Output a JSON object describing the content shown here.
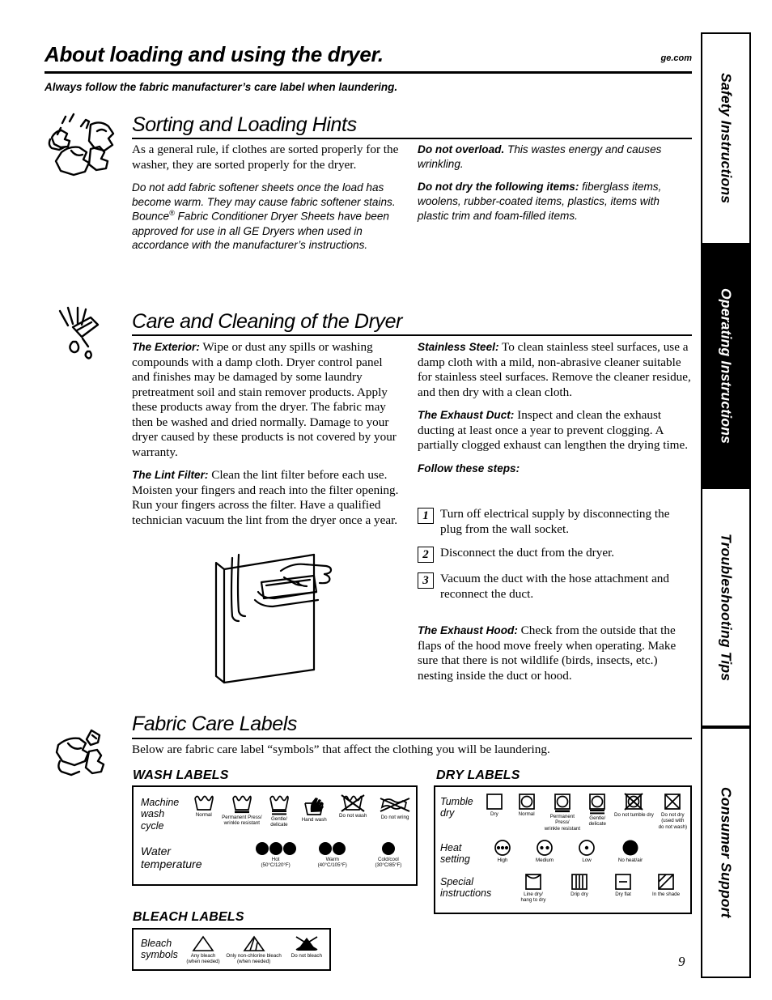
{
  "header": {
    "title": "About loading and using the dryer.",
    "url": "ge.com",
    "subhead": "Always follow the fabric manufacturer’s care label when laundering."
  },
  "sidebar": {
    "tabs": [
      {
        "label": "Safety Instructions",
        "active": false
      },
      {
        "label": "Operating Instructions",
        "active": true
      },
      {
        "label": "Troubleshooting Tips",
        "active": false
      },
      {
        "label": "Consumer Support",
        "active": false
      }
    ]
  },
  "sections": {
    "sorting": {
      "title": "Sorting and Loading Hints",
      "left": {
        "p1": "As a general rule, if clothes are sorted properly for the washer, they are sorted properly for the dryer.",
        "p2_a": "Do not add fabric softener sheets once the load has become warm. They may cause fabric softener stains. Bounce",
        "p2_sup": "®",
        "p2_b": " Fabric Conditioner Dryer Sheets have been approved for use in all GE Dryers when used in accordance with the manufacturer’s instructions."
      },
      "right": {
        "p1_lead": "Do not overload.",
        "p1_body": " This wastes energy and causes wrinkling.",
        "p2_lead": "Do not dry the following items:",
        "p2_body": " fiberglass items, woolens, rubber-coated items, plastics, items with plastic trim and foam-filled items."
      }
    },
    "care": {
      "title": "Care and Cleaning of the Dryer",
      "left": {
        "p1_lead": "The Exterior:",
        "p1_body": " Wipe or dust any spills or washing compounds with a damp cloth. Dryer control panel and finishes may be damaged by some laundry pretreatment soil and stain remover products. Apply these products away from the dryer. The fabric may then be washed and dried normally. Damage to your dryer caused by these products is not covered by your warranty.",
        "p2_lead": "The Lint Filter:",
        "p2_body": " Clean the lint filter before each use. Moisten your fingers and reach into the filter opening. Run your fingers across the filter. Have a qualified technician vacuum the lint from the dryer once a year."
      },
      "right": {
        "p1_lead": "Stainless Steel:",
        "p1_body": " To clean stainless steel surfaces, use a damp cloth with a mild, non-abrasive cleaner suitable for stainless steel surfaces. Remove the cleaner residue, and then dry with a clean cloth.",
        "p2_lead": "The Exhaust Duct:",
        "p2_body": " Inspect and clean the exhaust ducting at least once a year to prevent clogging. A partially clogged exhaust can lengthen the drying time.",
        "steps_label": "Follow these steps:",
        "steps": [
          {
            "num": "1",
            "text": "Turn off electrical supply by disconnecting the plug from the wall socket."
          },
          {
            "num": "2",
            "text": "Disconnect the duct from the dryer."
          },
          {
            "num": "3",
            "text": "Vacuum the duct with the hose attachment and reconnect the duct."
          }
        ],
        "p3_lead": "The Exhaust Hood:",
        "p3_body": " Check from the outside that the flaps of the hood move freely when operating. Make sure that there is not wildlife (birds, insects, etc.) nesting inside the duct or hood."
      }
    },
    "fabric": {
      "title": "Fabric Care Labels",
      "intro": "Below are fabric care label “symbols” that affect the clothing you will be laundering.",
      "wash_heading": "WASH LABELS",
      "dry_heading": "DRY LABELS",
      "bleach_heading": "BLEACH LABELS",
      "wash": {
        "row1_name": "Machine\nwash\ncycle",
        "row1": [
          {
            "icon": "wash-tub-icon",
            "caption": "Normal"
          },
          {
            "icon": "wash-tub-bar-icon",
            "caption": "Permanent Press/\nwrinkle resistant"
          },
          {
            "icon": "wash-tub-double-bar-icon",
            "caption": "Gentle/\ndelicate"
          },
          {
            "icon": "hand-wash-icon",
            "caption": "Hand wash"
          },
          {
            "icon": "do-not-wash-icon",
            "caption": "Do not wash"
          },
          {
            "icon": "do-not-wring-icon",
            "caption": "Do not wring"
          }
        ],
        "row2_name": "Water\ntemperature",
        "row2": [
          {
            "icon": "three-dots-icon",
            "dots": 3,
            "caption": "Hot\n(50°C/120°F)"
          },
          {
            "icon": "two-dots-icon",
            "dots": 2,
            "caption": "Warm\n(40°C/105°F)"
          },
          {
            "icon": "one-dot-icon",
            "dots": 1,
            "caption": "Cold/cool\n(30°C/85°F)"
          }
        ]
      },
      "bleach": {
        "row_name": "Bleach\nsymbols",
        "items": [
          {
            "icon": "triangle-icon",
            "caption": "Any bleach\n(when needed)"
          },
          {
            "icon": "triangle-stripes-icon",
            "caption": "Only non-chlorine bleach\n(when needed)"
          },
          {
            "icon": "triangle-filled-crossed-icon",
            "caption": "Do not bleach"
          }
        ]
      },
      "dry": {
        "row1_name": "Tumble\ndry",
        "row1": [
          {
            "icon": "square-icon",
            "caption": "Dry"
          },
          {
            "icon": "circle-in-square-icon",
            "caption": "Normal"
          },
          {
            "icon": "circle-square-bar-icon",
            "caption": "Permanent Press/\nwrinkle resistant"
          },
          {
            "icon": "circle-square-double-bar-icon",
            "caption": "Gentle/\ndelicate"
          },
          {
            "icon": "do-not-tumble-dry-icon",
            "caption": "Do not tumble dry"
          },
          {
            "icon": "do-not-dry-icon",
            "caption": "Do not dry\n(used with\ndo not wash)"
          }
        ],
        "row2_name": "Heat\nsetting",
        "row2": [
          {
            "icon": "circle-three-dots-icon",
            "dots": 3,
            "caption": "High"
          },
          {
            "icon": "circle-two-dots-icon",
            "dots": 2,
            "caption": "Medium"
          },
          {
            "icon": "circle-one-dot-icon",
            "dots": 1,
            "caption": "Low"
          },
          {
            "icon": "filled-circle-icon",
            "dots": 0,
            "caption": "No heat/air"
          }
        ],
        "row3_name": "Special\ninstructions",
        "row3": [
          {
            "icon": "line-dry-icon",
            "caption": "Line dry/\nhang to dry"
          },
          {
            "icon": "drip-dry-icon",
            "caption": "Drip dry"
          },
          {
            "icon": "dry-flat-icon",
            "caption": "Dry flat"
          },
          {
            "icon": "in-the-shade-icon",
            "caption": "In the shade"
          }
        ]
      }
    }
  },
  "footer": {
    "page_number": "9"
  }
}
